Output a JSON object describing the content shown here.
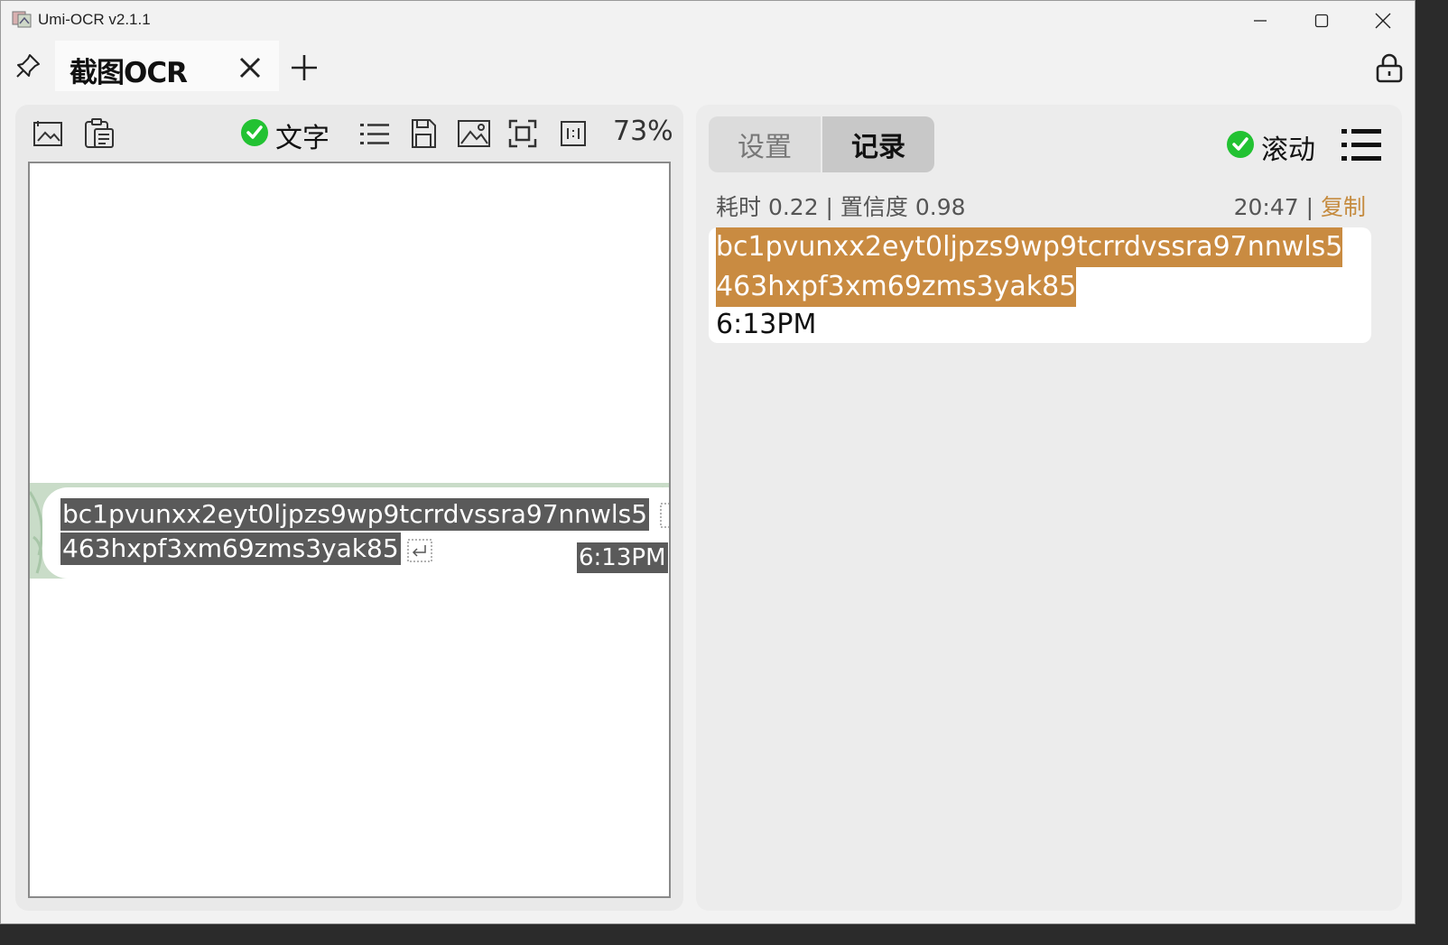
{
  "window": {
    "title": "Umi-OCR v2.1.1"
  },
  "tabs": [
    {
      "label": "截图OCR"
    }
  ],
  "left": {
    "toolbar": {
      "text_toggle_label": "文字",
      "text_toggle_checked": true,
      "zoom": "73%"
    },
    "ocr_lines": [
      "bc1pvunxx2eyt0ljpzs9wp9tcrrdvssra97nnwls5",
      "463hxpf3xm69zms3yak85",
      "6:13PM"
    ]
  },
  "right": {
    "tabs": {
      "settings": "设置",
      "records": "记录",
      "active": "记录"
    },
    "scroll_toggle": {
      "label": "滚动",
      "checked": true
    },
    "record": {
      "meta": "耗时 0.22 | 置信度 0.98",
      "time": "20:47",
      "separator": " | ",
      "copy_label": "复制",
      "lines": [
        "bc1pvunxx2eyt0ljpzs9wp9tcrrdvssra97nnwls5",
        "463hxpf3xm69zms3yak85",
        "6:13PM"
      ]
    }
  },
  "colors": {
    "check_green": "#22c232",
    "highlight": "#c98b41",
    "copy_link": "#c58b3f"
  }
}
